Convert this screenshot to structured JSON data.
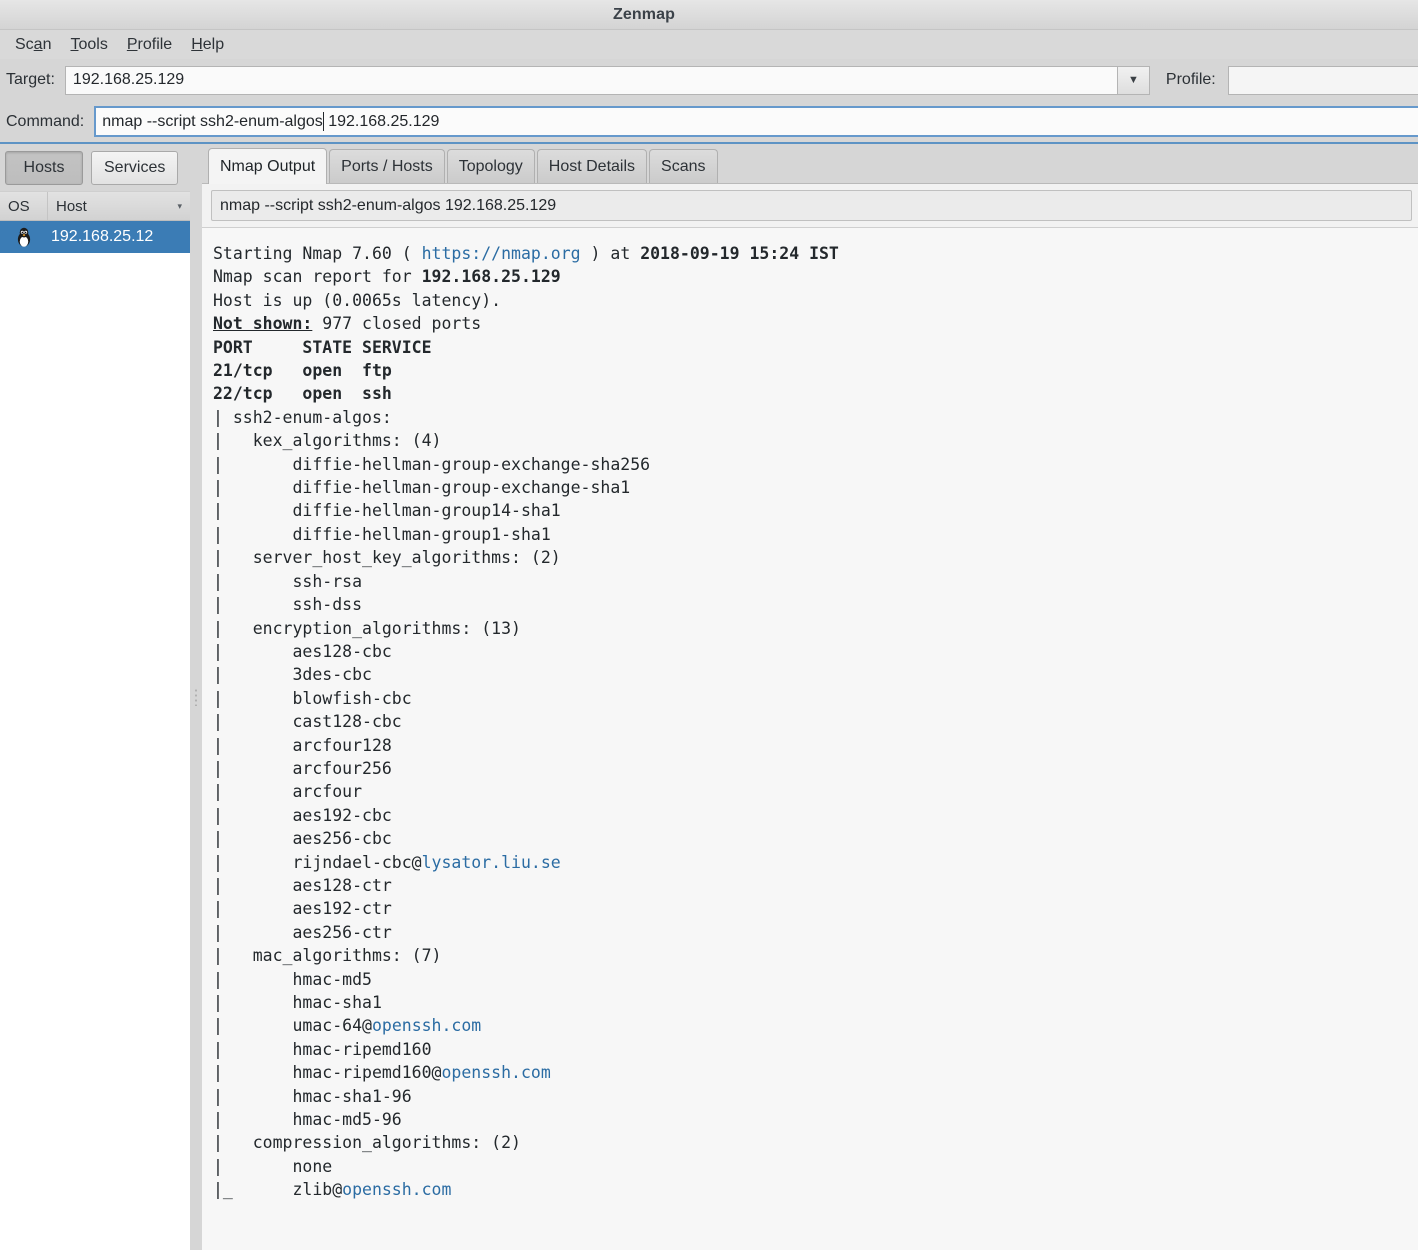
{
  "window": {
    "title": "Zenmap"
  },
  "menubar": {
    "items": [
      {
        "label": "Scan",
        "pre": "Sc",
        "mnemonic": "a",
        "post": "n"
      },
      {
        "label": "Tools",
        "pre": "",
        "mnemonic": "T",
        "post": "ools"
      },
      {
        "label": "Profile",
        "pre": "",
        "mnemonic": "P",
        "post": "rofile"
      },
      {
        "label": "Help",
        "pre": "",
        "mnemonic": "H",
        "post": "elp"
      }
    ]
  },
  "toolbar": {
    "target_label": "Target:",
    "target_value": "192.168.25.129",
    "target_placeholder": "",
    "dropdown_glyph": "▼",
    "profile_label": "Profile:",
    "profile_value": "",
    "profile_placeholder": "",
    "command_label": "Command:",
    "command_before_caret": "nmap --script ssh2-enum-algos",
    "command_after_caret": " 192.168.25.129"
  },
  "sidebar": {
    "buttons": [
      {
        "label": "Hosts",
        "active": true
      },
      {
        "label": "Services",
        "active": false
      }
    ],
    "columns": [
      {
        "label": "OS"
      },
      {
        "label": "Host"
      }
    ],
    "sort_glyph": "▾",
    "rows": [
      {
        "os_icon": "linux-penguin-icon",
        "host": "192.168.25.12",
        "selected": true
      }
    ]
  },
  "tabs": [
    {
      "label": "Nmap Output",
      "active": true
    },
    {
      "label": "Ports / Hosts",
      "active": false
    },
    {
      "label": "Topology",
      "active": false
    },
    {
      "label": "Host Details",
      "active": false
    },
    {
      "label": "Scans",
      "active": false
    }
  ],
  "command_display": "nmap --script ssh2-enum-algos 192.168.25.129",
  "colors": {
    "selection_blue": "#3b7cb5",
    "link_blue": "#2b6ca3",
    "tab_active_bg": "#f4f4f4",
    "output_bg": "#f7f7f7",
    "focus_border": "#6699cc"
  },
  "output": {
    "lines": [
      {
        "segments": [
          {
            "t": "Starting Nmap 7.60 ( "
          },
          {
            "t": "https://nmap.org",
            "link": true
          },
          {
            "t": " ) at "
          },
          {
            "t": "2018-09-19 15:24 IST",
            "bold": true
          }
        ]
      },
      {
        "segments": [
          {
            "t": "Nmap scan report for "
          },
          {
            "t": "192.168.25.129",
            "bold": true
          }
        ]
      },
      {
        "segments": [
          {
            "t": "Host is up (0.0065s latency)."
          }
        ]
      },
      {
        "segments": [
          {
            "t": "Not shown:",
            "bold": true,
            "underline": true
          },
          {
            "t": " 977 closed ports"
          }
        ]
      },
      {
        "segments": [
          {
            "t": "PORT     STATE SERVICE",
            "bold": true
          }
        ]
      },
      {
        "segments": [
          {
            "t": "21/tcp   open  ftp",
            "bold": true
          }
        ]
      },
      {
        "segments": [
          {
            "t": "22/tcp   open  ssh",
            "bold": true
          }
        ]
      },
      {
        "segments": [
          {
            "t": "| ssh2-enum-algos:"
          }
        ]
      },
      {
        "segments": [
          {
            "t": "|   kex_algorithms: (4)"
          }
        ]
      },
      {
        "segments": [
          {
            "t": "|       diffie-hellman-group-exchange-sha256"
          }
        ]
      },
      {
        "segments": [
          {
            "t": "|       diffie-hellman-group-exchange-sha1"
          }
        ]
      },
      {
        "segments": [
          {
            "t": "|       diffie-hellman-group14-sha1"
          }
        ]
      },
      {
        "segments": [
          {
            "t": "|       diffie-hellman-group1-sha1"
          }
        ]
      },
      {
        "segments": [
          {
            "t": "|   server_host_key_algorithms: (2)"
          }
        ]
      },
      {
        "segments": [
          {
            "t": "|       ssh-rsa"
          }
        ]
      },
      {
        "segments": [
          {
            "t": "|       ssh-dss"
          }
        ]
      },
      {
        "segments": [
          {
            "t": "|   encryption_algorithms: (13)"
          }
        ]
      },
      {
        "segments": [
          {
            "t": "|       aes128-cbc"
          }
        ]
      },
      {
        "segments": [
          {
            "t": "|       3des-cbc"
          }
        ]
      },
      {
        "segments": [
          {
            "t": "|       blowfish-cbc"
          }
        ]
      },
      {
        "segments": [
          {
            "t": "|       cast128-cbc"
          }
        ]
      },
      {
        "segments": [
          {
            "t": "|       arcfour128"
          }
        ]
      },
      {
        "segments": [
          {
            "t": "|       arcfour256"
          }
        ]
      },
      {
        "segments": [
          {
            "t": "|       arcfour"
          }
        ]
      },
      {
        "segments": [
          {
            "t": "|       aes192-cbc"
          }
        ]
      },
      {
        "segments": [
          {
            "t": "|       aes256-cbc"
          }
        ]
      },
      {
        "segments": [
          {
            "t": "|       rijndael-cbc@"
          },
          {
            "t": "lysator.liu.se",
            "link": true
          }
        ]
      },
      {
        "segments": [
          {
            "t": "|       aes128-ctr"
          }
        ]
      },
      {
        "segments": [
          {
            "t": "|       aes192-ctr"
          }
        ]
      },
      {
        "segments": [
          {
            "t": "|       aes256-ctr"
          }
        ]
      },
      {
        "segments": [
          {
            "t": "|   mac_algorithms: (7)"
          }
        ]
      },
      {
        "segments": [
          {
            "t": "|       hmac-md5"
          }
        ]
      },
      {
        "segments": [
          {
            "t": "|       hmac-sha1"
          }
        ]
      },
      {
        "segments": [
          {
            "t": "|       umac-64@"
          },
          {
            "t": "openssh.com",
            "link": true
          }
        ]
      },
      {
        "segments": [
          {
            "t": "|       hmac-ripemd160"
          }
        ]
      },
      {
        "segments": [
          {
            "t": "|       hmac-ripemd160@"
          },
          {
            "t": "openssh.com",
            "link": true
          }
        ]
      },
      {
        "segments": [
          {
            "t": "|       hmac-sha1-96"
          }
        ]
      },
      {
        "segments": [
          {
            "t": "|       hmac-md5-96"
          }
        ]
      },
      {
        "segments": [
          {
            "t": "|   compression_algorithms: (2)"
          }
        ]
      },
      {
        "segments": [
          {
            "t": "|       none"
          }
        ]
      },
      {
        "segments": [
          {
            "t": "|_      zlib@"
          },
          {
            "t": "openssh.com",
            "link": true
          }
        ]
      }
    ]
  }
}
